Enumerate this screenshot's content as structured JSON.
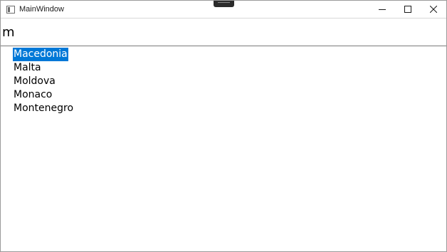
{
  "window": {
    "title": "MainWindow"
  },
  "search": {
    "value": "m"
  },
  "results": [
    {
      "label": "Macedonia",
      "selected": true
    },
    {
      "label": "Malta",
      "selected": false
    },
    {
      "label": "Moldova",
      "selected": false
    },
    {
      "label": "Monaco",
      "selected": false
    },
    {
      "label": "Montenegro",
      "selected": false
    }
  ],
  "colors": {
    "selection": "#0078d7",
    "selection_text": "#ffffff"
  },
  "icons": {
    "app": "app-window-icon",
    "minimize": "minimize-icon",
    "maximize": "maximize-icon",
    "close": "close-icon"
  }
}
